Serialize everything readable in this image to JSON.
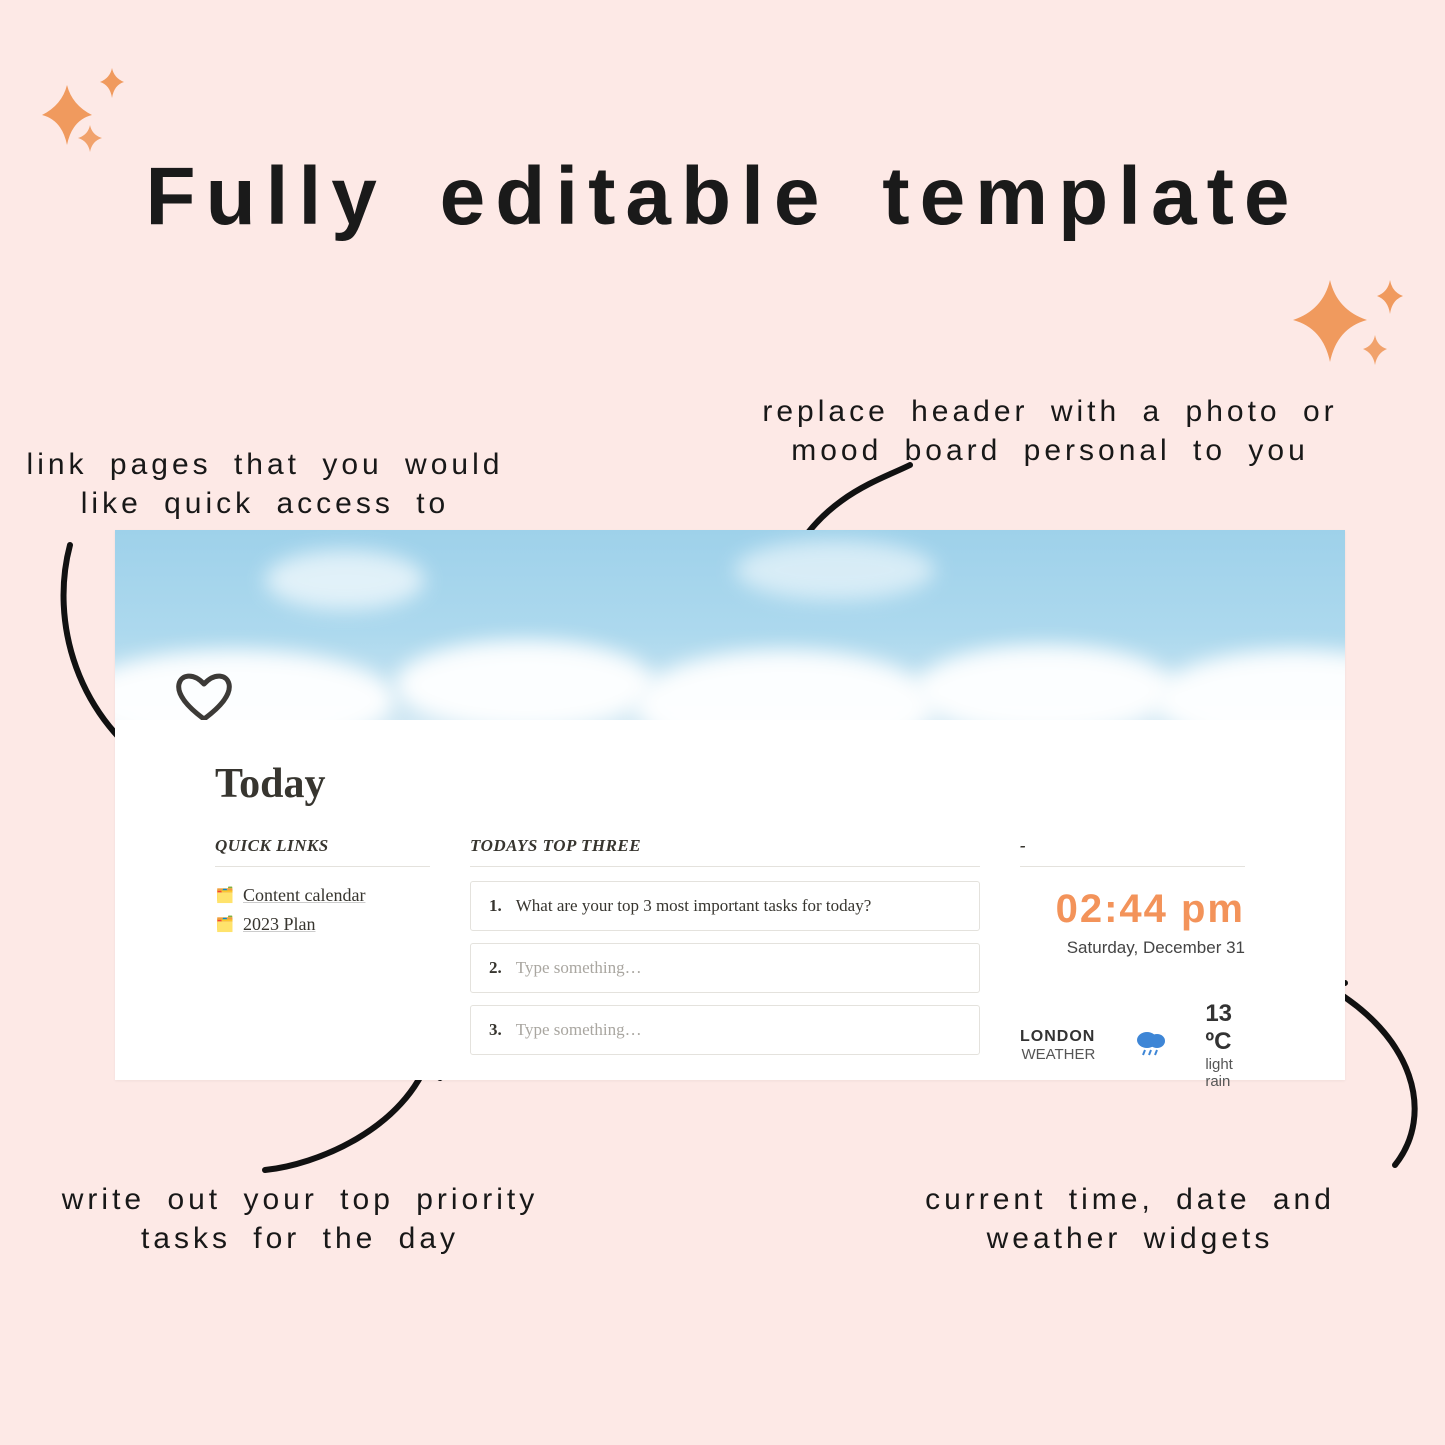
{
  "title": "Fully  editable  template",
  "annotations": {
    "header": "replace  header  with  a  photo  or\nmood  board  personal  to  you",
    "links": "link  pages  that  you  would\nlike  quick  access  to",
    "tasks": "write  out  your  top  priority\ntasks  for  the  day",
    "widgets": "current  time,  date  and\nweather  widgets"
  },
  "page": {
    "title": "Today",
    "sections": {
      "quick_links_label": "QUICK LINKS",
      "top_three_label": "TODAYS TOP THREE",
      "widgets_label": "-"
    },
    "quick_links": [
      {
        "icon": "page-icon",
        "label": "Content calendar"
      },
      {
        "icon": "page-icon",
        "label": "2023 Plan"
      }
    ],
    "tasks": [
      {
        "num": "1.",
        "text": "What are your top 3 most important tasks for today?",
        "placeholder": false
      },
      {
        "num": "2.",
        "text": "Type something…",
        "placeholder": true
      },
      {
        "num": "3.",
        "text": "Type something…",
        "placeholder": true
      }
    ],
    "clock": {
      "time": "02:44 pm",
      "date": "Saturday, December 31"
    },
    "weather": {
      "city": "LONDON",
      "label": "WEATHER",
      "icon": "rain-cloud-icon",
      "temp": "13 ºC",
      "desc": "light rain"
    }
  },
  "colors": {
    "bg": "#fde9e6",
    "accent": "#f3935a",
    "sparkle": "#f09a5e"
  }
}
